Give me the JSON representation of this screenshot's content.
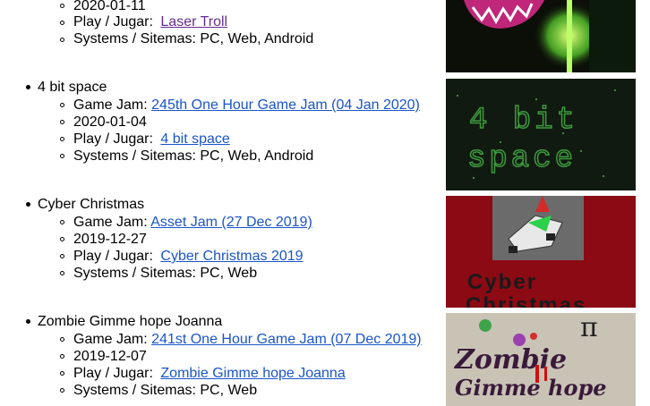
{
  "entries": [
    {
      "title": "",
      "date": "2020-01-11",
      "play_label": "Play / Jugar:",
      "play_link": "Laser Troll",
      "systems_label": "Systems / Sitemas:",
      "systems": "PC, Web, Android"
    },
    {
      "title": "4 bit space",
      "jam_label": "Game Jam:",
      "jam_link": "245th One Hour Game Jam (04 Jan 2020)",
      "date": "2020-01-04",
      "play_label": "Play / Jugar:",
      "play_link": "4 bit space",
      "systems_label": "Systems / Sitemas:",
      "systems": "PC, Web, Android",
      "thumb_text_1": "4 bit",
      "thumb_text_2": "space"
    },
    {
      "title": "Cyber Christmas",
      "jam_label": "Game Jam:",
      "jam_link": "Asset Jam (27 Dec 2019)",
      "date": "2019-12-27",
      "play_label": "Play / Jugar:",
      "play_link": "Cyber Christmas 2019",
      "systems_label": "Systems / Sitemas:",
      "systems": "PC, Web",
      "thumb_text_1": "Cyber",
      "thumb_text_2": "Christmas"
    },
    {
      "title": "Zombie Gimme hope Joanna",
      "jam_label": "Game Jam:",
      "jam_link": "241st One Hour Game Jam (07 Dec 2019)",
      "date": "2019-12-07",
      "play_label": "Play / Jugar:",
      "play_link": "Zombie Gimme hope Joanna",
      "systems_label": "Systems / Sitemas:",
      "systems": "PC, Web",
      "thumb_text_1": "Zombie",
      "thumb_text_2": "Gimme hope",
      "thumb_symbol": "π"
    }
  ],
  "colors": {
    "link": "#1a55c9",
    "visited_link": "#662d91",
    "cyber_bg": "#8b0a14",
    "space_bg": "#111a11"
  }
}
